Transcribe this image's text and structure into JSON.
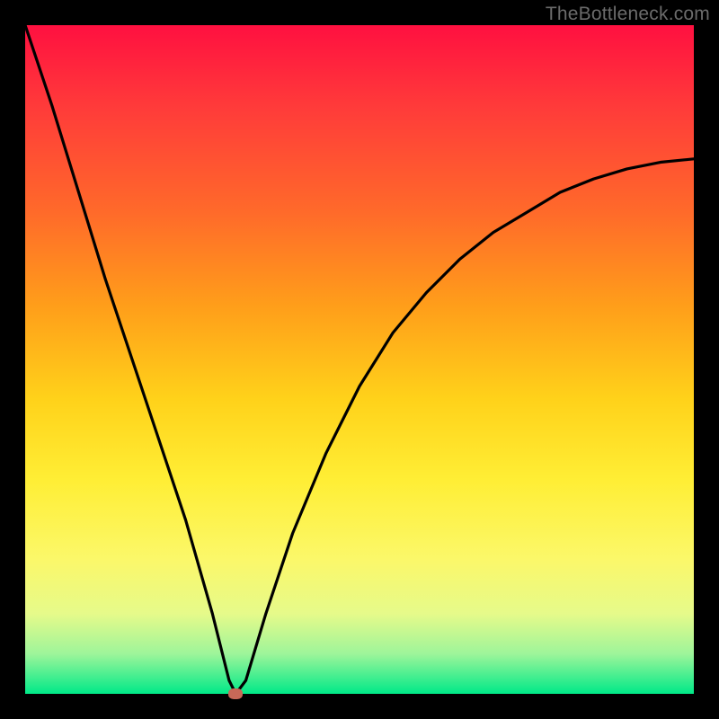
{
  "watermark": "TheBottleneck.com",
  "chart_data": {
    "type": "line",
    "title": "",
    "xlabel": "",
    "ylabel": "",
    "xlim": [
      0,
      100
    ],
    "ylim": [
      0,
      100
    ],
    "grid": false,
    "legend": false,
    "background_gradient": {
      "top": "#ff1040",
      "upper_mid": "#ff9e1a",
      "mid": "#ffee35",
      "lower_mid": "#e6fa8a",
      "bottom": "#00e988"
    },
    "series": [
      {
        "name": "bottleneck-curve",
        "x": [
          0,
          4,
          8,
          12,
          16,
          20,
          24,
          28,
          30.5,
          31.5,
          33,
          36,
          40,
          45,
          50,
          55,
          60,
          65,
          70,
          75,
          80,
          85,
          90,
          95,
          100
        ],
        "values": [
          100,
          88,
          75,
          62,
          50,
          38,
          26,
          12,
          2,
          0,
          2,
          12,
          24,
          36,
          46,
          54,
          60,
          65,
          69,
          72,
          75,
          77,
          78.5,
          79.5,
          80
        ]
      }
    ],
    "marker": {
      "x": 31.5,
      "y": 0,
      "color": "#c86858"
    }
  }
}
